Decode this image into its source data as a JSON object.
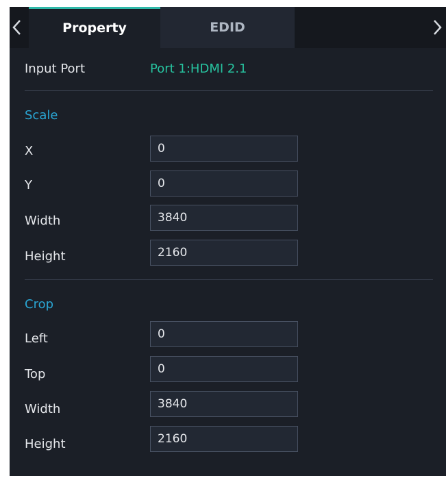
{
  "tabs": {
    "property": "Property",
    "edid": "EDID",
    "active": "Property"
  },
  "icons": {
    "left": "chevron-left-icon",
    "right": "chevron-right-icon"
  },
  "input_port": {
    "label": "Input Port",
    "value": "Port 1:HDMI 2.1"
  },
  "scale": {
    "title": "Scale",
    "x_label": "X",
    "x_value": "0",
    "y_label": "Y",
    "y_value": "0",
    "width_label": "Width",
    "width_value": "3840",
    "height_label": "Height",
    "height_value": "2160"
  },
  "crop": {
    "title": "Crop",
    "left_label": "Left",
    "left_value": "0",
    "top_label": "Top",
    "top_value": "0",
    "width_label": "Width",
    "width_value": "3840",
    "height_label": "Height",
    "height_value": "2160"
  },
  "colors": {
    "accent_teal": "#27c4a0",
    "section_blue": "#2aa6d4",
    "background": "#1b1f27"
  }
}
